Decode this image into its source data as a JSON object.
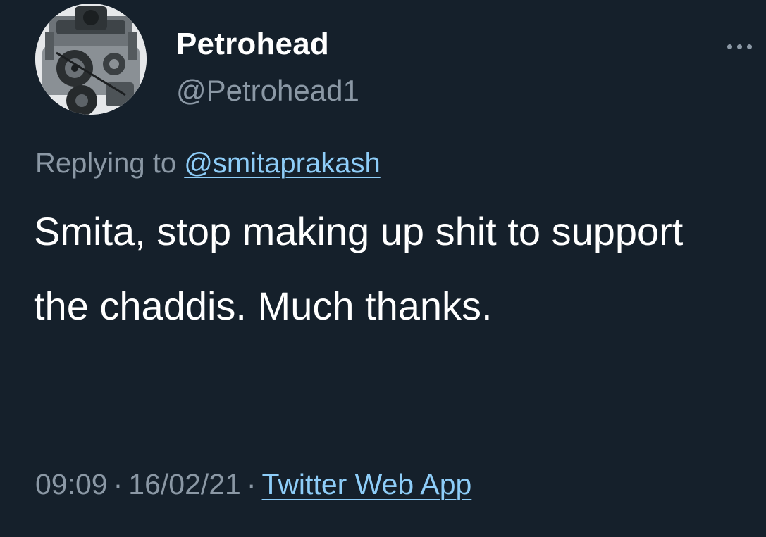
{
  "tweet": {
    "author": {
      "display_name": "Petrohead",
      "handle": "@Petrohead1",
      "avatar_icon": "engine-avatar-image"
    },
    "more_icon": "more-horizontal-icon",
    "reply_prefix": "Replying to",
    "reply_to": "@smitaprakash",
    "text": "Smita, stop making up shit to support the chaddis. Much thanks.",
    "time": "09:09",
    "date": "16/02/21",
    "separator": "·",
    "source": "Twitter Web App"
  },
  "colors": {
    "background": "#15202b",
    "primary_text": "#ffffff",
    "secondary_text": "#8b98a5",
    "link": "#8ecdf8"
  }
}
